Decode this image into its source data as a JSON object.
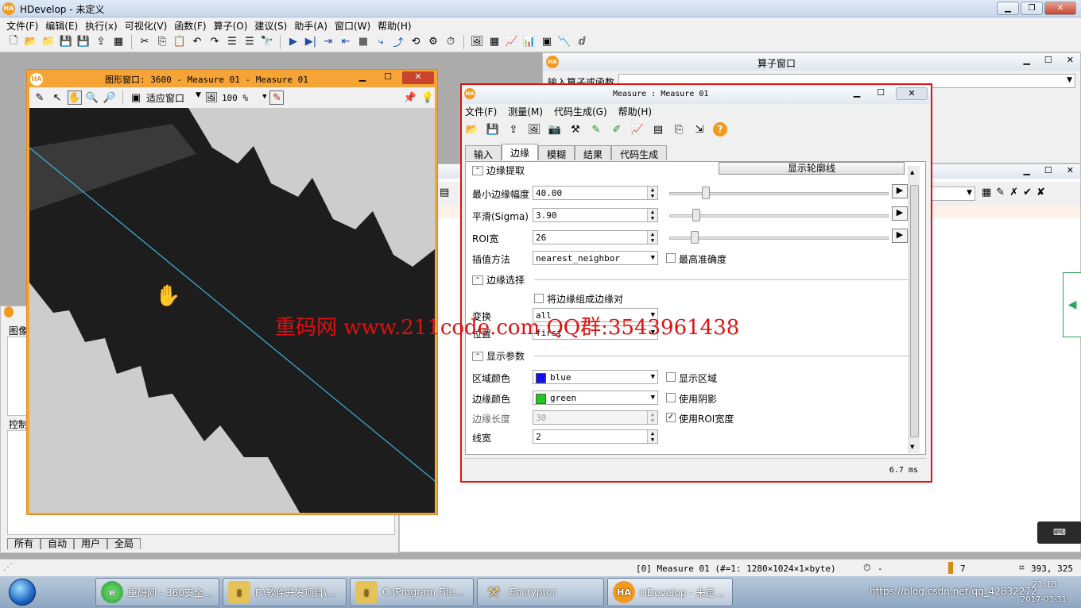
{
  "app": {
    "title": "HDevelop - 未定义",
    "logo": "HA"
  },
  "menubar": [
    "文件(F)",
    "编辑(E)",
    "执行(x)",
    "可视化(V)",
    "函数(F)",
    "算子(O)",
    "建议(S)",
    "助手(A)",
    "窗口(W)",
    "帮助(H)"
  ],
  "operator_window": {
    "title": "算子窗口",
    "input_label": "输入算子或函数"
  },
  "graphics_window": {
    "title": "图形窗口: 3600 - Measure 01 - Measure 01",
    "fit_label": "适应窗口",
    "zoom": "100 %"
  },
  "left_dock": {
    "label_image": "图像",
    "label_control": "控制",
    "tabs": [
      "所有",
      "自动",
      "用户",
      "全局"
    ]
  },
  "measure": {
    "title": "Measure : Measure 01",
    "menu": [
      "文件(F)",
      "测量(M)",
      "代码生成(G)",
      "帮助(H)"
    ],
    "tabs": [
      "输入",
      "边缘",
      "模糊",
      "结果",
      "代码生成"
    ],
    "active_tab": "边缘",
    "section_extract": "边缘提取",
    "show_contour_btn": "显示轮廓线",
    "min_amp_label": "最小边缘幅度",
    "min_amp": "40.00",
    "sigma_label": "平滑(Sigma)",
    "sigma": "3.90",
    "roi_label": "ROI宽",
    "roi": "26",
    "interp_label": "插值方法",
    "interp": "nearest_neighbor",
    "max_precision_label": "最高准确度",
    "section_select": "边缘选择",
    "pair_label": "将边缘组成边缘对",
    "transition_label": "变换",
    "transition": "all",
    "position_label": "位置",
    "position": "first",
    "section_display": "显示参数",
    "region_color_label": "区域颜色",
    "region_color": "blue",
    "show_region_label": "显示区域",
    "edge_color_label": "边缘颜色",
    "edge_color": "green",
    "shadow_label": "使用阴影",
    "edge_len_label": "边缘长度",
    "edge_len": "30",
    "use_roi_width_label": "使用ROI宽度",
    "line_width_label": "线宽",
    "line_width": "2",
    "timing": "6.7 ms"
  },
  "colors": {
    "region": "#1010e8",
    "edge": "#20c820",
    "highlight": "#e01010",
    "graphics_frame": "#f6a435"
  },
  "watermark": "重码网 www.211code.com QQ群:3543961438",
  "statusbar": {
    "image_info": "[0] Measure 01 (#=1: 1280×1024×1×byte)",
    "timer": "-",
    "count": "7",
    "coords": "393, 325"
  },
  "taskbar": {
    "items": [
      "重码网 - 360安全...",
      "F:\\软件开发项目\\...",
      "C:\\Program File...",
      "Encryptor",
      "HDevelop - 未定..."
    ],
    "tray_url": "https://blog.csdn.net/qq_42832272",
    "time": "21:13",
    "date": "2017-03-31"
  }
}
